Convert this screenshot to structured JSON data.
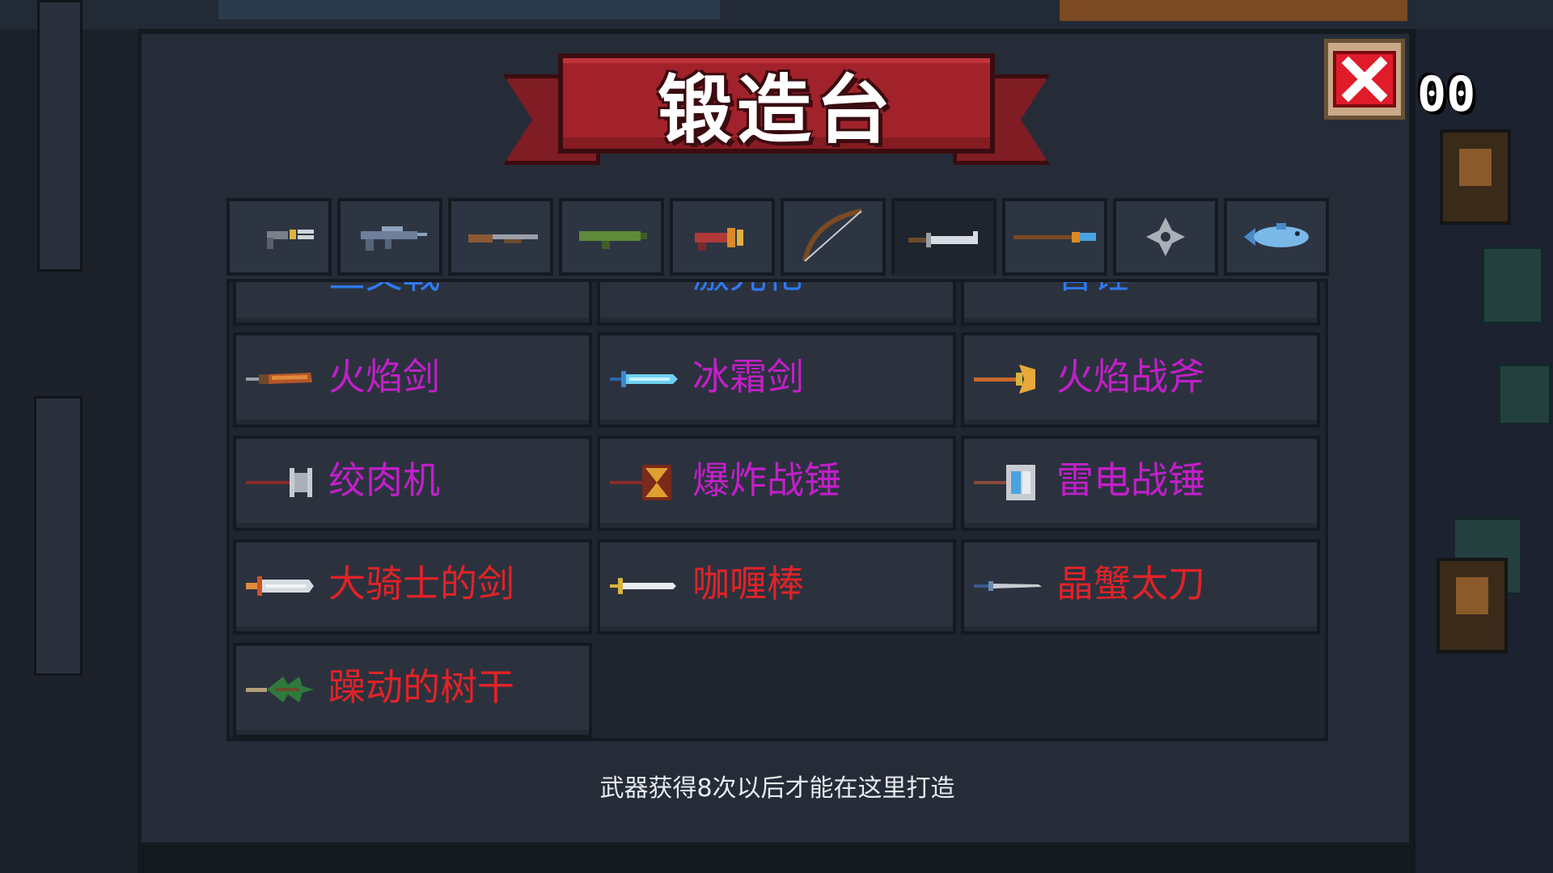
{
  "title": "锻造台",
  "counter": "00",
  "tabs": [
    {
      "icon": "pistol-icon",
      "active": false
    },
    {
      "icon": "rifle-icon",
      "active": false
    },
    {
      "icon": "shotgun-icon",
      "active": false
    },
    {
      "icon": "rocket-launcher-icon",
      "active": false
    },
    {
      "icon": "laser-gun-icon",
      "active": false
    },
    {
      "icon": "bow-icon",
      "active": false
    },
    {
      "icon": "sword-icon",
      "active": true
    },
    {
      "icon": "spear-icon",
      "active": false
    },
    {
      "icon": "shuriken-icon",
      "active": false
    },
    {
      "icon": "fish-icon",
      "active": false
    }
  ],
  "partial_items": [
    {
      "label": "三叉戟",
      "color": "blue"
    },
    {
      "label": "激光枪",
      "color": "blue"
    },
    {
      "label": "音锤",
      "color": "blue"
    }
  ],
  "items": [
    {
      "label": "火焰剑",
      "icon": "fire-sword-icon",
      "color": "purple"
    },
    {
      "label": "冰霜剑",
      "icon": "frost-sword-icon",
      "color": "purple"
    },
    {
      "label": "火焰战斧",
      "icon": "fire-axe-icon",
      "color": "purple"
    },
    {
      "label": "绞肉机",
      "icon": "meat-grinder-icon",
      "color": "purple"
    },
    {
      "label": "爆炸战锤",
      "icon": "explosive-hammer-icon",
      "color": "purple"
    },
    {
      "label": "雷电战锤",
      "icon": "thunder-hammer-icon",
      "color": "purple"
    },
    {
      "label": "大骑士的剑",
      "icon": "knight-sword-icon",
      "color": "red"
    },
    {
      "label": "咖喱棒",
      "icon": "excalibur-icon",
      "color": "red"
    },
    {
      "label": "晶蟹太刀",
      "icon": "crystal-katana-icon",
      "color": "red"
    },
    {
      "label": "躁动的树干",
      "icon": "restless-trunk-icon",
      "color": "red"
    }
  ],
  "hint": "武器获得8次以后才能在这里打造",
  "colors": {
    "purple": "#c21fc9",
    "red": "#e02328",
    "blue": "#2f79f0",
    "banner": "#a2222b",
    "close": "#e01b2a"
  }
}
